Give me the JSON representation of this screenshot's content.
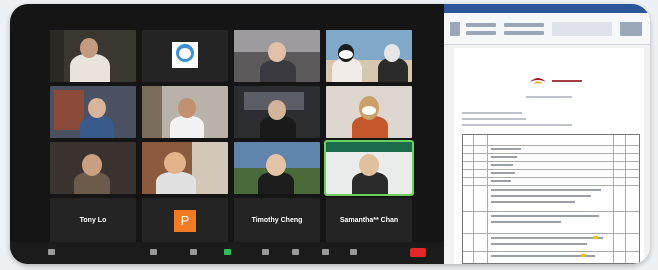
{
  "zoom": {
    "participants": [
      {
        "name": "",
        "type": "video"
      },
      {
        "name": "",
        "type": "video"
      },
      {
        "name": "",
        "type": "video"
      },
      {
        "name": "",
        "type": "video"
      },
      {
        "name": "",
        "type": "video"
      },
      {
        "name": "",
        "type": "video"
      },
      {
        "name": "",
        "type": "video"
      },
      {
        "name": "",
        "type": "video"
      },
      {
        "name": "",
        "type": "video"
      },
      {
        "name": "",
        "type": "video"
      },
      {
        "name": "",
        "type": "video"
      },
      {
        "name": "",
        "type": "video",
        "active": true
      },
      {
        "name": "Tony Lo",
        "type": "name"
      },
      {
        "name": "P",
        "type": "avatar"
      },
      {
        "name": "Timothy Cheng",
        "type": "name"
      },
      {
        "name": "Samantha** Chan",
        "type": "name"
      }
    ]
  },
  "colors": {
    "active_speaker": "#6bd35c",
    "end_button": "#e02828",
    "avatar": "#f07b22",
    "word_ribbon": "#2b579a"
  }
}
